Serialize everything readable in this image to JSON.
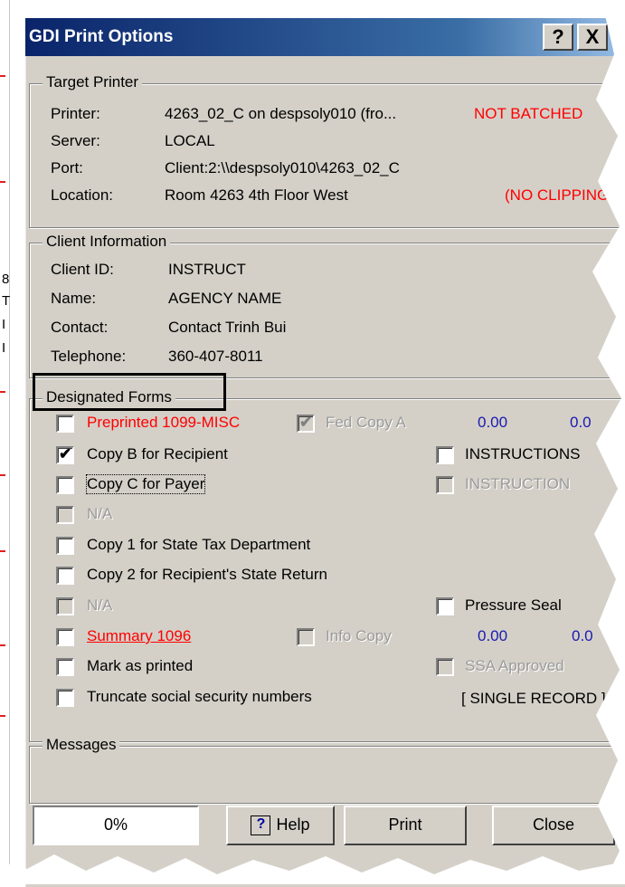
{
  "window": {
    "title": "GDI Print Options",
    "help_btn": "?",
    "close_btn": "X"
  },
  "target_printer": {
    "legend": "Target Printer",
    "rows": [
      {
        "label": "Printer:",
        "value": "4263_02_C on despsoly010 (fro...",
        "extra": "NOT BATCHED"
      },
      {
        "label": "Server:",
        "value": "LOCAL"
      },
      {
        "label": "Port:",
        "value": "Client:2:\\\\despsoly010\\4263_02_C"
      },
      {
        "label": "Location:",
        "value": "Room 4263 4th Floor West",
        "extra": "(NO CLIPPING)"
      }
    ]
  },
  "client_info": {
    "legend": "Client Information",
    "rows": [
      {
        "label": "Client ID:",
        "value": "INSTRUCT"
      },
      {
        "label": "Name:",
        "value": "AGENCY NAME"
      },
      {
        "label": "Contact:",
        "value": "Contact Trinh Bui"
      },
      {
        "label": "Telephone:",
        "value": "360-407-8011"
      }
    ]
  },
  "forms": {
    "legend": "Designated Forms",
    "preprinted": "Preprinted 1099-MISC",
    "fed_copy_a": "Fed Copy A",
    "fed_val1": "0.00",
    "fed_val2": "0.0",
    "copy_b": "Copy B for Recipient",
    "instructions1": "INSTRUCTIONS",
    "copy_c": "Copy C for Payer",
    "instructions2": "INSTRUCTION",
    "na1": "N/A",
    "copy_1": "Copy 1 for State Tax Department",
    "copy_2": "Copy 2 for Recipient's State Return",
    "na2": "N/A",
    "pressure_seal": "Pressure Seal",
    "summary": "Summary 1096",
    "info_copy": "Info Copy",
    "sum_val1": "0.00",
    "sum_val2": "0.0",
    "mark_printed": "Mark as printed",
    "ssa": "SSA Approved",
    "truncate": "Truncate social security numbers",
    "single_record": "[ SINGLE RECORD ]"
  },
  "messages": {
    "legend": "Messages"
  },
  "buttons": {
    "progress": "0%",
    "help": "Help",
    "print": "Print",
    "close": "Close"
  },
  "background": {
    "char1": "8",
    "char2": "T",
    "char3": "I",
    "char4": "I"
  },
  "colors": {
    "titlebar": "#0a246a",
    "dialog": "#d4d0c8",
    "alert": "#ff0000",
    "value_blue": "#1a1ab0"
  }
}
